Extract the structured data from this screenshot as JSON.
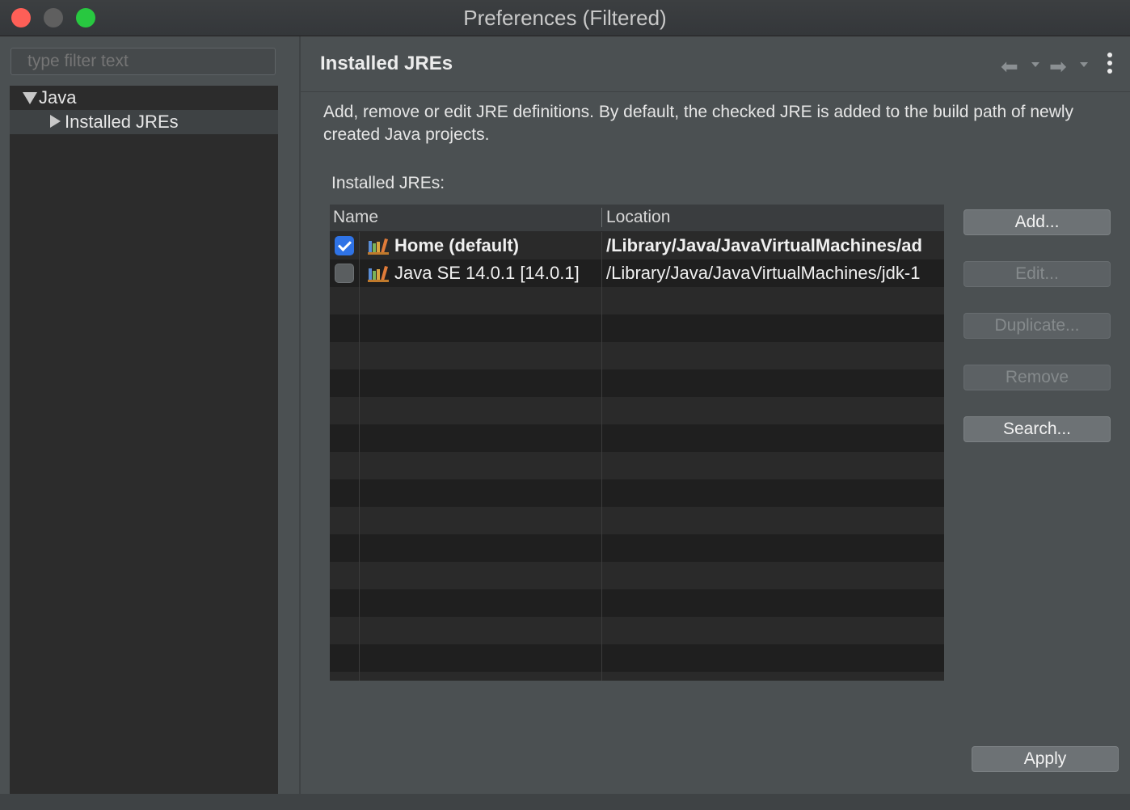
{
  "window": {
    "title": "Preferences (Filtered)"
  },
  "sidebar": {
    "filter_placeholder": "type filter text",
    "tree": [
      {
        "label": "Java",
        "expanded": true
      },
      {
        "label": "Installed JREs",
        "selected": true
      }
    ]
  },
  "page": {
    "title": "Installed JREs",
    "description": "Add, remove or edit JRE definitions. By default, the checked JRE is added to the build path of newly created Java projects.",
    "table_caption": "Installed JREs:",
    "columns": [
      "Name",
      "Location"
    ],
    "rows": [
      {
        "checked": true,
        "name": "Home (default)",
        "location": "/Library/Java/JavaVirtualMachines/ad",
        "bold": true
      },
      {
        "checked": false,
        "name": "Java SE 14.0.1 [14.0.1]",
        "location": "/Library/Java/JavaVirtualMachines/jdk-1",
        "bold": false
      }
    ],
    "buttons": {
      "add": "Add...",
      "edit": "Edit...",
      "duplicate": "Duplicate...",
      "remove": "Remove",
      "search": "Search..."
    },
    "apply": "Apply"
  },
  "colors": {
    "accent": "#2f73e6",
    "close": "#fe5f57",
    "maximize": "#28c840"
  }
}
